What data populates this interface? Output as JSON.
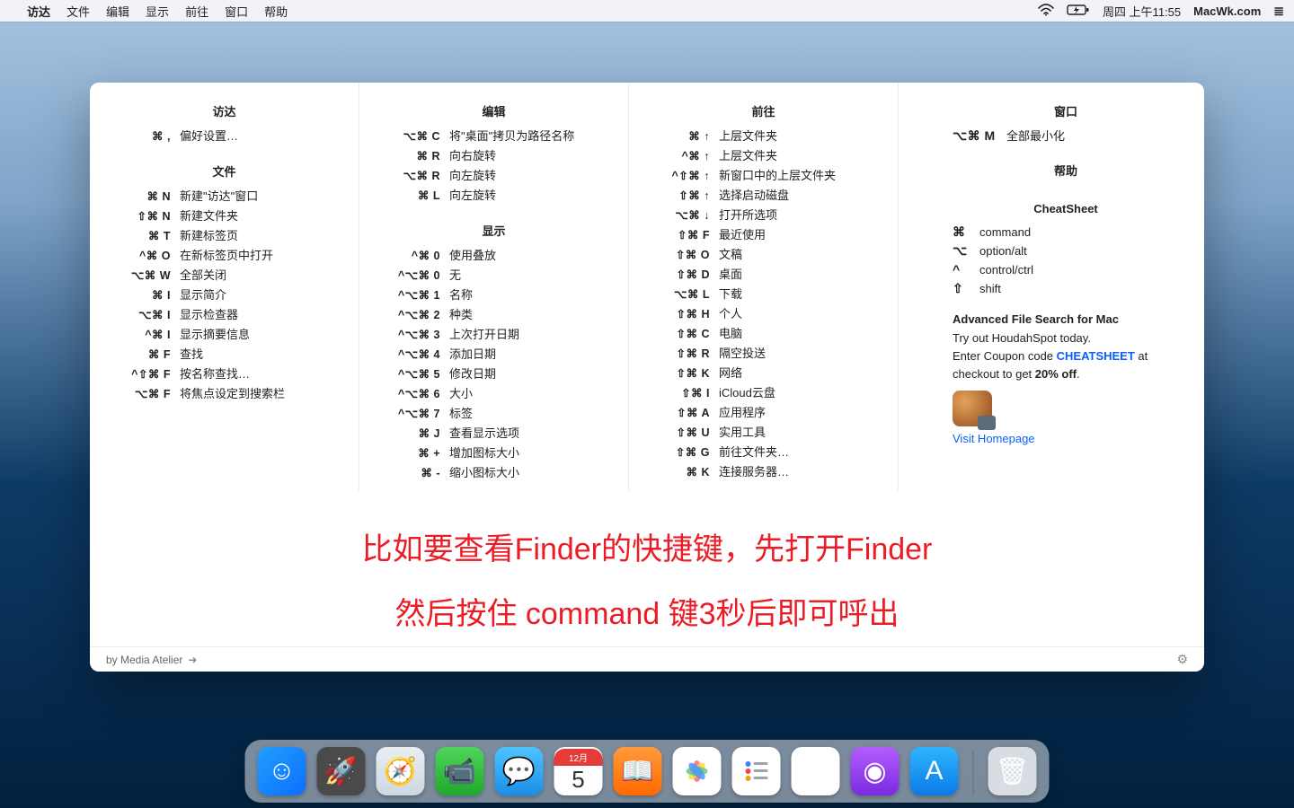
{
  "menubar": {
    "apple": "",
    "app": "访达",
    "items": [
      "文件",
      "编辑",
      "显示",
      "前往",
      "窗口",
      "帮助"
    ],
    "right": {
      "wifi": "wifi",
      "battery": "battery-charging",
      "clock": "周四 上午11:55",
      "site": "MacWk.com",
      "menu": "≣"
    }
  },
  "sheet": {
    "col1": {
      "g1": {
        "title": "访达",
        "rows": [
          {
            "k": "⌘ ,",
            "l": "偏好设置…"
          }
        ]
      },
      "g2": {
        "title": "文件",
        "rows": [
          {
            "k": "⌘ N",
            "l": "新建\"访达\"窗口"
          },
          {
            "k": "⇧⌘ N",
            "l": "新建文件夹"
          },
          {
            "k": "⌘ T",
            "l": "新建标签页"
          },
          {
            "k": "^⌘ O",
            "l": "在新标签页中打开"
          },
          {
            "k": "⌥⌘ W",
            "l": "全部关闭"
          },
          {
            "k": "⌘ I",
            "l": "显示简介"
          },
          {
            "k": "⌥⌘ I",
            "l": "显示检查器"
          },
          {
            "k": "^⌘ I",
            "l": "显示摘要信息"
          },
          {
            "k": "⌘ F",
            "l": "查找"
          },
          {
            "k": "^⇧⌘ F",
            "l": "按名称查找…"
          },
          {
            "k": "⌥⌘ F",
            "l": "将焦点设定到搜索栏"
          }
        ]
      }
    },
    "col2": {
      "g1": {
        "title": "编辑",
        "rows": [
          {
            "k": "⌥⌘ C",
            "l": "将\"桌面\"拷贝为路径名称"
          },
          {
            "k": "⌘ R",
            "l": "向右旋转"
          },
          {
            "k": "⌥⌘ R",
            "l": "向左旋转"
          },
          {
            "k": "⌘ L",
            "l": "向左旋转"
          }
        ]
      },
      "g2": {
        "title": "显示",
        "rows": [
          {
            "k": "^⌘ 0",
            "l": "使用叠放"
          },
          {
            "k": "^⌥⌘ 0",
            "l": "无"
          },
          {
            "k": "^⌥⌘ 1",
            "l": "名称"
          },
          {
            "k": "^⌥⌘ 2",
            "l": "种类"
          },
          {
            "k": "^⌥⌘ 3",
            "l": "上次打开日期"
          },
          {
            "k": "^⌥⌘ 4",
            "l": "添加日期"
          },
          {
            "k": "^⌥⌘ 5",
            "l": "修改日期"
          },
          {
            "k": "^⌥⌘ 6",
            "l": "大小"
          },
          {
            "k": "^⌥⌘ 7",
            "l": "标签"
          },
          {
            "k": "⌘ J",
            "l": "查看显示选项"
          },
          {
            "k": "⌘ +",
            "l": "增加图标大小"
          },
          {
            "k": "⌘ -",
            "l": "缩小图标大小"
          }
        ]
      }
    },
    "col3": {
      "g1": {
        "title": "前往",
        "rows": [
          {
            "k": "⌘ ↑",
            "l": "上层文件夹"
          },
          {
            "k": "^⌘ ↑",
            "l": "上层文件夹"
          },
          {
            "k": "^⇧⌘ ↑",
            "l": "新窗口中的上层文件夹"
          },
          {
            "k": "⇧⌘ ↑",
            "l": "选择启动磁盘"
          },
          {
            "k": "⌥⌘ ↓",
            "l": "打开所选项"
          },
          {
            "k": "⇧⌘ F",
            "l": "最近使用"
          },
          {
            "k": "⇧⌘ O",
            "l": "文稿"
          },
          {
            "k": "⇧⌘ D",
            "l": "桌面"
          },
          {
            "k": "⌥⌘ L",
            "l": "下载"
          },
          {
            "k": "⇧⌘ H",
            "l": "个人"
          },
          {
            "k": "⇧⌘ C",
            "l": "电脑"
          },
          {
            "k": "⇧⌘ R",
            "l": "隔空投送"
          },
          {
            "k": "⇧⌘ K",
            "l": "网络"
          },
          {
            "k": "⇧⌘ I",
            "l": "iCloud云盘"
          },
          {
            "k": "⇧⌘ A",
            "l": "应用程序"
          },
          {
            "k": "⇧⌘ U",
            "l": "实用工具"
          },
          {
            "k": "⇧⌘ G",
            "l": "前往文件夹…"
          },
          {
            "k": "⌘ K",
            "l": "连接服务器…"
          }
        ]
      }
    },
    "col4": {
      "g1": {
        "title": "窗口",
        "rows": [
          {
            "k": "⌥⌘ M",
            "l": "全部最小化"
          }
        ]
      },
      "g2": {
        "title": "帮助",
        "rows": []
      },
      "g3": {
        "title": "CheatSheet",
        "rows": [
          {
            "k": "⌘",
            "l": "command"
          },
          {
            "k": "⌥",
            "l": "option/alt"
          },
          {
            "k": "^",
            "l": "control/ctrl"
          },
          {
            "k": "⇧",
            "l": "shift"
          }
        ]
      },
      "ad": {
        "title": "Advanced File Search for Mac",
        "line1": "Try out HoudahSpot today.",
        "line2a": "Enter Coupon code ",
        "code": "CHEATSHEET",
        "line2b": " at checkout to get ",
        "pct": "20% off",
        "dot": ".",
        "link": "Visit Homepage"
      }
    },
    "red1": "比如要查看Finder的快捷键，先打开Finder",
    "red2": "然后按住 command 键3秒后即可呼出",
    "footer": {
      "by": "by Media Atelier",
      "arrow": "➜",
      "gear": "⚙"
    }
  },
  "dock": {
    "cal_month": "12月",
    "cal_day": "5",
    "apps": [
      "finder",
      "launchpad",
      "safari",
      "facetime",
      "messages",
      "calendar",
      "books",
      "photos",
      "reminders",
      "music",
      "podcasts",
      "appstore"
    ],
    "trash": "trash"
  }
}
